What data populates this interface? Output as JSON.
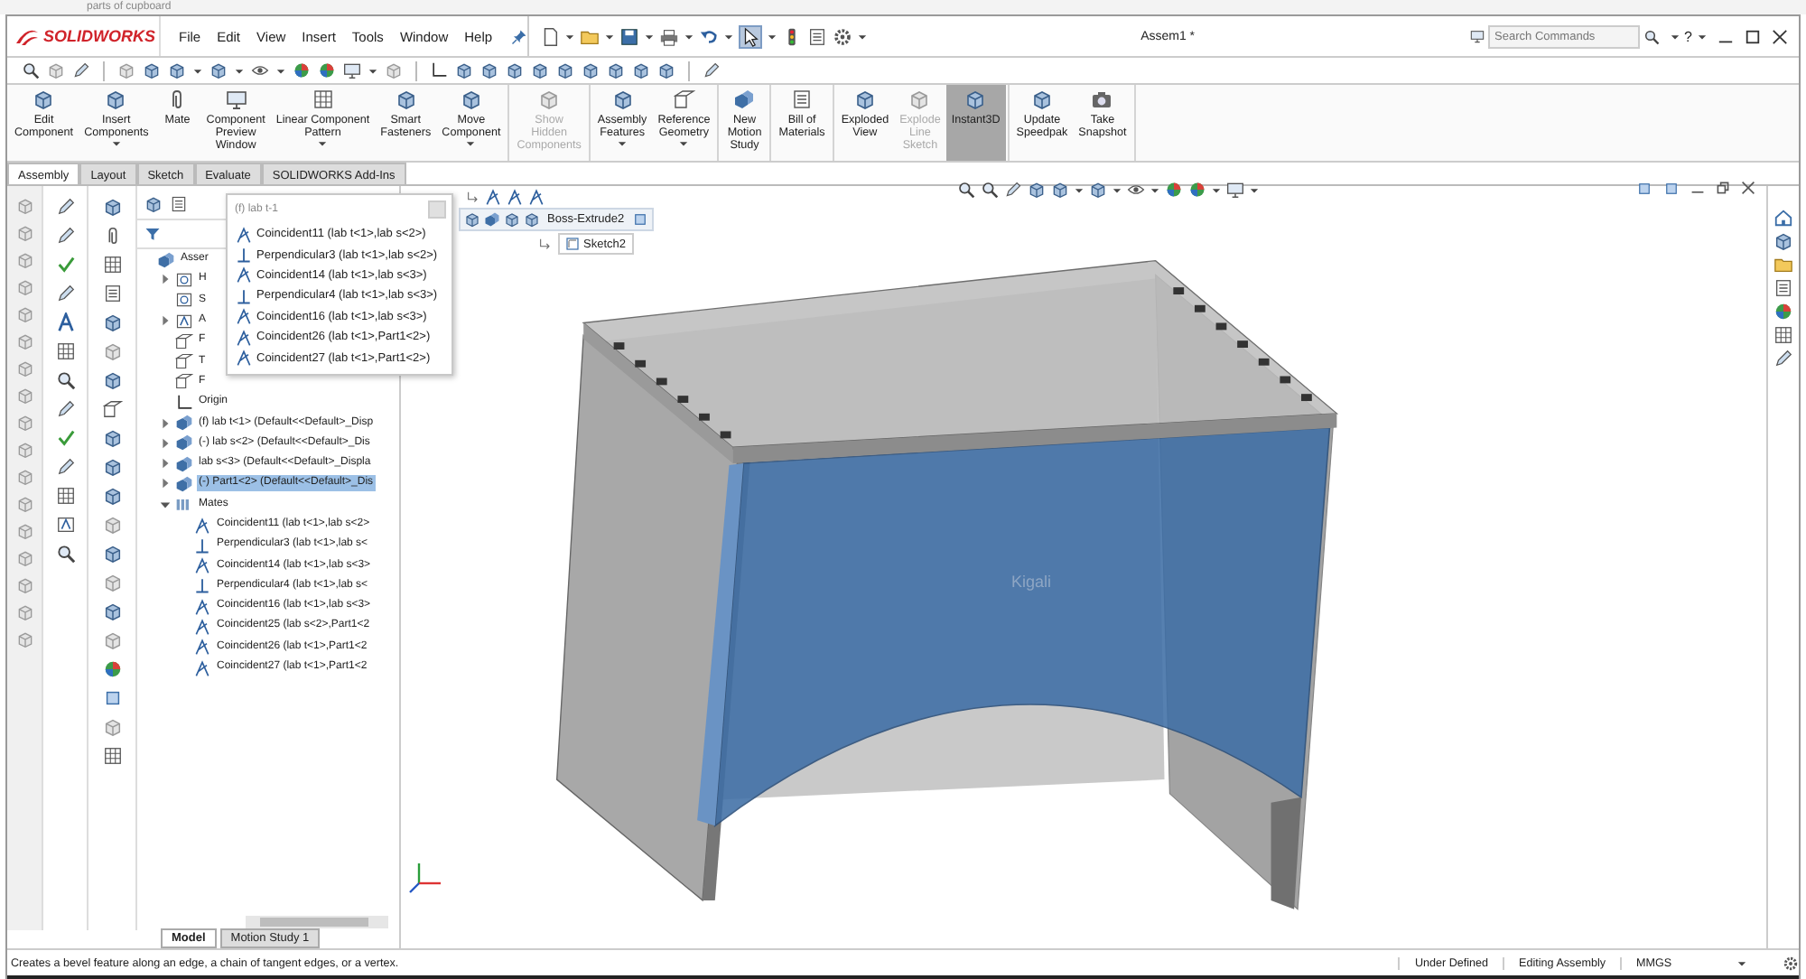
{
  "background_window": {
    "title": "parts of cupboard"
  },
  "app": {
    "logo": "SOLIDWORKS",
    "menu": [
      "File",
      "Edit",
      "View",
      "Insert",
      "Tools",
      "Window",
      "Help"
    ],
    "document_title": "Assem1 *",
    "search": {
      "placeholder": "Search Commands"
    },
    "help": "?"
  },
  "ribbon": {
    "groups": [
      [
        {
          "lines": [
            "Edit",
            "Component"
          ],
          "dropdown": false,
          "disabled": false,
          "selected": false
        },
        {
          "lines": [
            "Insert",
            "Components"
          ],
          "dropdown": true,
          "disabled": false,
          "selected": false
        },
        {
          "lines": [
            "Mate"
          ],
          "dropdown": false,
          "disabled": false,
          "selected": false
        },
        {
          "lines": [
            "Component",
            "Preview",
            "Window"
          ],
          "dropdown": false,
          "disabled": false,
          "selected": false
        },
        {
          "lines": [
            "Linear Component",
            "Pattern"
          ],
          "dropdown": true,
          "disabled": false,
          "selected": false
        },
        {
          "lines": [
            "Smart",
            "Fasteners"
          ],
          "dropdown": false,
          "disabled": false,
          "selected": false
        },
        {
          "lines": [
            "Move",
            "Component"
          ],
          "dropdown": true,
          "disabled": false,
          "selected": false
        }
      ],
      [
        {
          "lines": [
            "Show",
            "Hidden",
            "Components"
          ],
          "dropdown": false,
          "disabled": true,
          "selected": false
        }
      ],
      [
        {
          "lines": [
            "Assembly",
            "Features"
          ],
          "dropdown": true,
          "disabled": false,
          "selected": false
        },
        {
          "lines": [
            "Reference",
            "Geometry"
          ],
          "dropdown": true,
          "disabled": false,
          "selected": false
        }
      ],
      [
        {
          "lines": [
            "New",
            "Motion",
            "Study"
          ],
          "dropdown": false,
          "disabled": false,
          "selected": false
        }
      ],
      [
        {
          "lines": [
            "Bill of",
            "Materials"
          ],
          "dropdown": false,
          "disabled": false,
          "selected": false
        }
      ],
      [
        {
          "lines": [
            "Exploded",
            "View"
          ],
          "dropdown": false,
          "disabled": false,
          "selected": false
        },
        {
          "lines": [
            "Explode",
            "Line",
            "Sketch"
          ],
          "dropdown": false,
          "disabled": true,
          "selected": false
        },
        {
          "lines": [
            "Instant3D"
          ],
          "dropdown": false,
          "disabled": false,
          "selected": true
        }
      ],
      [
        {
          "lines": [
            "Update",
            "Speedpak"
          ],
          "dropdown": false,
          "disabled": false,
          "selected": false
        },
        {
          "lines": [
            "Take",
            "Snapshot"
          ],
          "dropdown": false,
          "disabled": false,
          "selected": false
        }
      ]
    ]
  },
  "ribbon_tabs": [
    {
      "label": "Assembly",
      "selected": true
    },
    {
      "label": "Layout",
      "selected": false
    },
    {
      "label": "Sketch",
      "selected": false
    },
    {
      "label": "Evaluate",
      "selected": false
    },
    {
      "label": "SOLIDWORKS Add-Ins",
      "selected": false
    }
  ],
  "feature_tree": {
    "items": [
      {
        "label": "Asser",
        "kind": "assembly",
        "selected": false,
        "children": [
          {
            "label": "H",
            "kind": "history",
            "expanded": false,
            "selected": false
          },
          {
            "label": "S",
            "kind": "sensor",
            "selected": false
          },
          {
            "label": "A",
            "kind": "annotation",
            "expanded": false,
            "selected": false
          },
          {
            "label": "F",
            "kind": "plane",
            "selected": false
          },
          {
            "label": "T",
            "kind": "plane",
            "selected": false
          },
          {
            "label": "F",
            "kind": "plane",
            "selected": false
          },
          {
            "label": "Origin",
            "kind": "origin",
            "selected": false
          },
          {
            "label": "(f) lab t<1> (Default<<Default>_Disp",
            "kind": "part",
            "expanded": false,
            "selected": false
          },
          {
            "label": "(-) lab s<2> (Default<<Default>_Dis",
            "kind": "part",
            "expanded": false,
            "selected": false
          },
          {
            "label": "lab s<3> (Default<<Default>_Displa",
            "kind": "part",
            "expanded": false,
            "selected": false
          },
          {
            "label": "(-) Part1<2> (Default<<Default>_Dis",
            "kind": "part",
            "expanded": false,
            "selected": true
          },
          {
            "label": "Mates",
            "kind": "mates",
            "expanded": true,
            "selected": false,
            "children": [
              {
                "label": "Coincident11 (lab t<1>,lab s<2>",
                "kind": "coincident",
                "selected": false
              },
              {
                "label": "Perpendicular3 (lab t<1>,lab s<",
                "kind": "perpendicular",
                "selected": false
              },
              {
                "label": "Coincident14 (lab t<1>,lab s<3>",
                "kind": "coincident",
                "selected": false
              },
              {
                "label": "Perpendicular4 (lab t<1>,lab s<",
                "kind": "perpendicular",
                "selected": false
              },
              {
                "label": "Coincident16 (lab t<1>,lab s<3>",
                "kind": "coincident",
                "selected": false
              },
              {
                "label": "Coincident25 (lab s<2>,Part1<2",
                "kind": "coincident",
                "selected": false
              },
              {
                "label": "Coincident26 (lab t<1>,Part1<2",
                "kind": "coincident",
                "selected": false
              },
              {
                "label": "Coincident27 (lab t<1>,Part1<2",
                "kind": "coincident",
                "selected": false
              }
            ]
          }
        ]
      }
    ]
  },
  "mate_popup": {
    "title": "(f) lab t-1",
    "items": [
      {
        "label": "Coincident11 (lab t<1>,lab s<2>)",
        "kind": "coincident"
      },
      {
        "label": "Perpendicular3 (lab t<1>,lab s<2>)",
        "kind": "perpendicular"
      },
      {
        "label": "Coincident14 (lab t<1>,lab s<3>)",
        "kind": "coincident"
      },
      {
        "label": "Perpendicular4 (lab t<1>,lab s<3>)",
        "kind": "perpendicular"
      },
      {
        "label": "Coincident16 (lab t<1>,lab s<3>)",
        "kind": "coincident"
      },
      {
        "label": "Coincident26 (lab t<1>,Part1<2>)",
        "kind": "coincident"
      },
      {
        "label": "Coincident27 (lab t<1>,Part1<2>)",
        "kind": "coincident"
      }
    ]
  },
  "breadcrumb": {
    "feature": "Boss-Extrude2",
    "sketch": "Sketch2"
  },
  "viewport": {
    "model_label": "Kigali"
  },
  "bottom_tabs": [
    {
      "label": "Model",
      "selected": true
    },
    {
      "label": "Motion Study 1",
      "selected": false
    }
  ],
  "status_bar": {
    "message": "Creates a bevel feature along an edge, a chain of tangent edges, or a vertex.",
    "state": "Under Defined",
    "mode": "Editing Assembly",
    "units": "MMGS"
  }
}
